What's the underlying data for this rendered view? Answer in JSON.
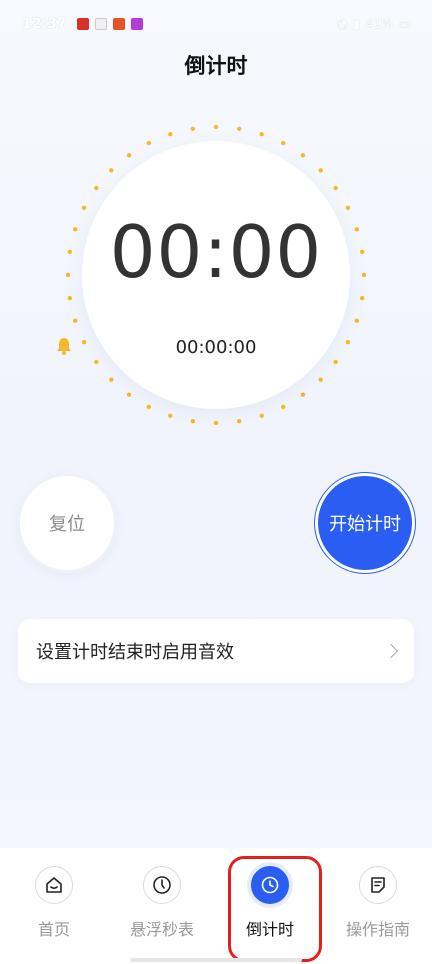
{
  "status": {
    "time": "12:37",
    "battery": "41%"
  },
  "title": "倒计时",
  "timer": {
    "display": "00:00",
    "alarm_time": "00:00:00"
  },
  "buttons": {
    "reset": "复位",
    "start": "开始计时"
  },
  "setting": {
    "label": "设置计时结束时启用音效"
  },
  "nav": {
    "items": [
      {
        "label": "首页",
        "icon": "home-icon"
      },
      {
        "label": "悬浮秒表",
        "icon": "stopwatch-icon"
      },
      {
        "label": "倒计时",
        "icon": "countdown-clock-icon"
      },
      {
        "label": "操作指南",
        "icon": "guide-icon"
      }
    ],
    "active_index": 2
  },
  "colors": {
    "accent": "#2a5ef2",
    "dot": "#f5b82e",
    "highlight": "#e32020"
  }
}
